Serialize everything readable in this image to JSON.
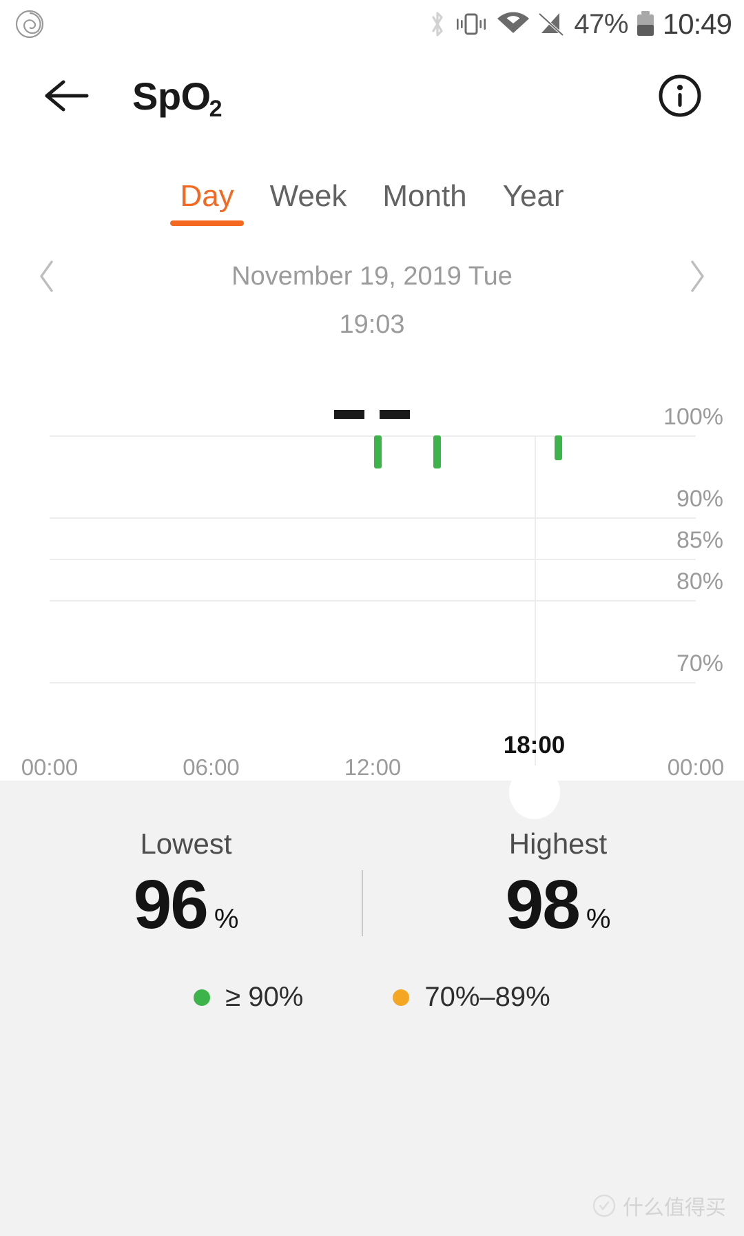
{
  "statusbar": {
    "battery_percent": "47%",
    "clock": "10:49",
    "icons": {
      "app_logo": "spiral-logo-icon",
      "bluetooth": "bluetooth-icon",
      "vibrate": "vibrate-icon",
      "wifi": "wifi-icon",
      "no_signal": "no-sim-signal-icon",
      "battery": "battery-icon"
    }
  },
  "appbar": {
    "back": "back-arrow-icon",
    "title": "SpO",
    "title_sub": "2",
    "info": "info-circle-icon"
  },
  "tabs": [
    {
      "label": "Day",
      "active": true
    },
    {
      "label": "Week",
      "active": false
    },
    {
      "label": "Month",
      "active": false
    },
    {
      "label": "Year",
      "active": false
    }
  ],
  "datenav": {
    "prev": "chevron-left-icon",
    "next": "chevron-right-icon",
    "date": "November 19, 2019 Tue"
  },
  "readout": {
    "time": "19:03",
    "value": "--"
  },
  "chart_data": {
    "type": "bar",
    "title": "SpO2 Day",
    "xlabel": "",
    "ylabel": "%",
    "ylim": [
      65,
      102
    ],
    "xlim": [
      0,
      24
    ],
    "grid": true,
    "legend_position": "bottom",
    "y_ticks": [
      100,
      90,
      85,
      80,
      70
    ],
    "y_tick_labels": [
      "100%",
      "90%",
      "85%",
      "80%",
      "70%"
    ],
    "x_ticks": [
      0,
      6,
      12,
      24
    ],
    "x_tick_labels": [
      "00:00",
      "06:00",
      "12:00",
      "00:00"
    ],
    "cursor": {
      "x": 18,
      "label": "18:00"
    },
    "series": [
      {
        "name": "SpO2 readings",
        "color": "#3CB44A",
        "points": [
          {
            "x": 12.2,
            "low": 96,
            "high": 100
          },
          {
            "x": 14.4,
            "low": 96,
            "high": 100
          },
          {
            "x": 18.9,
            "low": 97,
            "high": 100
          }
        ]
      }
    ],
    "legend": [
      {
        "label": "≥ 90%",
        "color": "#3CB44A"
      },
      {
        "label": "70%–89%",
        "color": "#F5A623"
      }
    ]
  },
  "stats": {
    "lowest": {
      "label": "Lowest",
      "value": "96",
      "unit": "%"
    },
    "highest": {
      "label": "Highest",
      "value": "98",
      "unit": "%"
    }
  },
  "legend": [
    {
      "label": "≥ 90%",
      "color": "#3CB44A"
    },
    {
      "label": "70%–89%",
      "color": "#F5A623"
    }
  ],
  "watermark": {
    "text": "什么值得买"
  },
  "colors": {
    "accent": "#F4681F",
    "green": "#3CB44A",
    "orange": "#F5A623",
    "panel_bg": "#F2F2F2"
  }
}
